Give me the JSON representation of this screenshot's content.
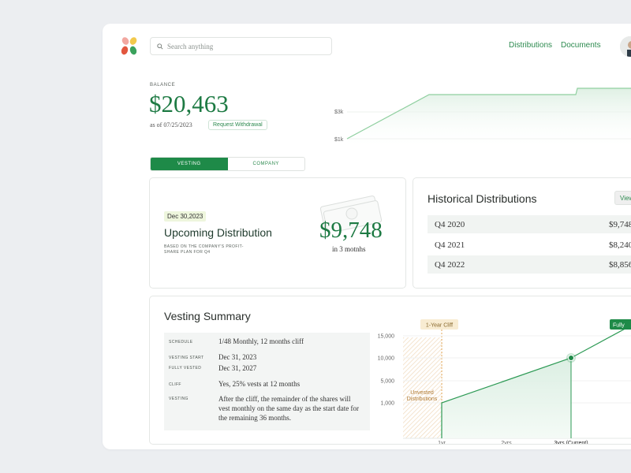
{
  "nav": {
    "search_placeholder": "Search anything",
    "links": [
      "Distributions",
      "Documents"
    ]
  },
  "balance": {
    "label": "BALANCE",
    "value": "$20,463",
    "as_of": "as of 07/25/2023",
    "withdraw_label": "Request Withdrawal"
  },
  "top_chart": {
    "y_ticks": [
      "$3k",
      "$1k"
    ]
  },
  "tabs": [
    "VESTING",
    "COMPANY"
  ],
  "upcoming": {
    "date": "Dec 30,2023",
    "title": "Upcoming Distribution",
    "subtitle": "BASED ON THE COMPANY'S PROFIT-SHARE PLAN FOR Q4",
    "amount": "$9,748",
    "in_text": "in 3 motnhs"
  },
  "historical": {
    "title": "Historical Distributions",
    "view_label": "View",
    "rows": [
      {
        "quarter": "Q4 2020",
        "value": "$9,748"
      },
      {
        "quarter": "Q4 2021",
        "value": "$8,240"
      },
      {
        "quarter": "Q4 2022",
        "value": "$8,856"
      }
    ]
  },
  "vesting": {
    "title": "Vesting Summary",
    "rows": [
      {
        "label": "SCHEDULE",
        "value": "1/48 Monthly, 12 months cliff"
      },
      {
        "label": "VESTING START",
        "value": "Dec 31, 2023"
      },
      {
        "label": "FULLY VESTED",
        "value": "Dec 31, 2027"
      },
      {
        "label": "CLIFF",
        "value": "Yes, 25% vests at 12 months"
      },
      {
        "label": "VESTING",
        "value": "After the cliff, the remainder of the shares will vest monthly on the same day as the start date for the remaining 36 months."
      }
    ]
  },
  "chart_data": {
    "type": "line",
    "y_ticks": [
      "15,000",
      "10,000",
      "5,000",
      "1,000"
    ],
    "x_labels": [
      "1yr",
      "2yrs",
      "3yrs (Current)"
    ],
    "annotations": {
      "cliff": "1-Year Cliff",
      "fully": "Fully",
      "unvested_line1": "Unvested",
      "unvested_line2": "Distributions"
    },
    "series": [
      {
        "x": [
          1,
          3,
          4
        ],
        "y": [
          1000,
          10000,
          17000
        ]
      }
    ],
    "current_point": {
      "x": 3,
      "y": 10000
    },
    "colors": {
      "line": "#2d9a55",
      "cliff": "#e3a95b"
    }
  },
  "colors": {
    "brand": "#1e8a48",
    "accent_text": "#2d8a4f"
  }
}
